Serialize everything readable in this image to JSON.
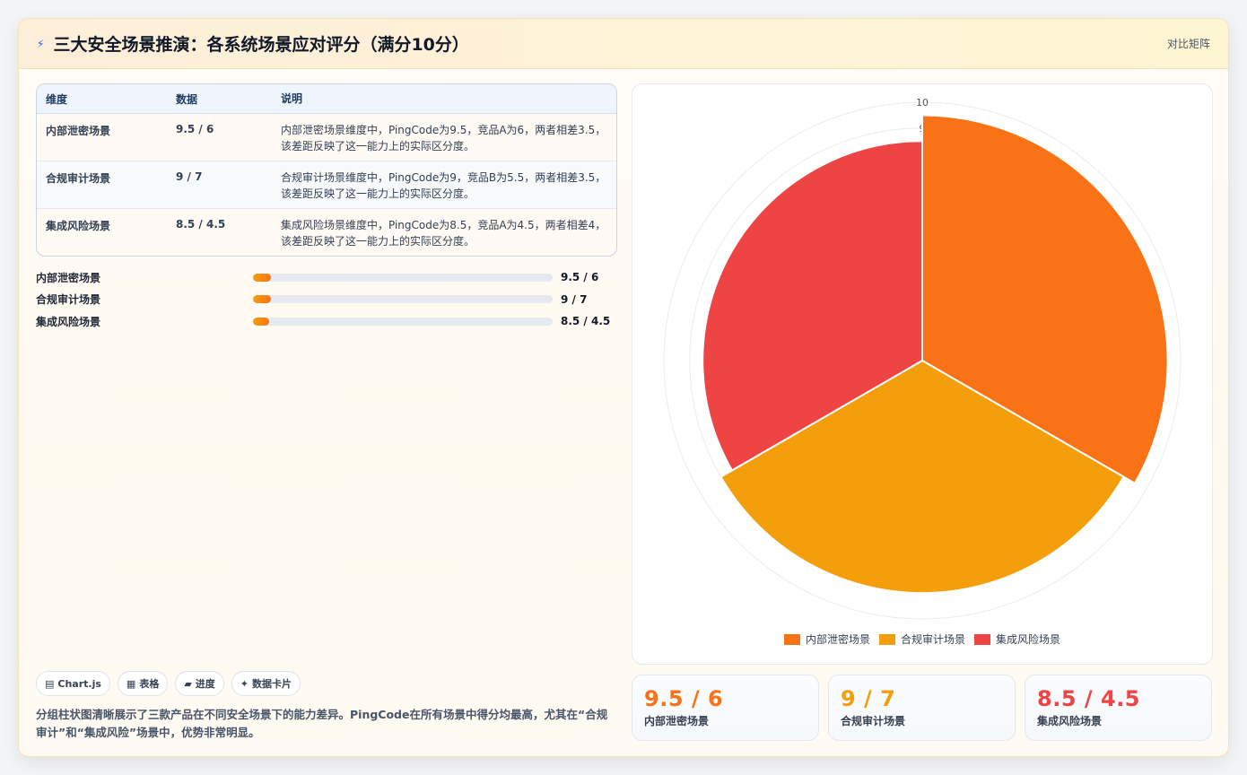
{
  "header": {
    "icon": "bolt-icon",
    "title": "三大安全场景推演：各系统场景应对评分（满分10分）",
    "switch_label": "对比矩阵"
  },
  "table": {
    "headers": [
      "维度",
      "数据",
      "说明"
    ],
    "rows": [
      {
        "dimension": "内部泄密场景",
        "data": "9.5 / 6",
        "note": "内部泄密场景维度中，PingCode为9.5，竞品A为6，两者相差3.5，该差距反映了这一能力上的实际区分度。"
      },
      {
        "dimension": "合规审计场景",
        "data": "9 / 7",
        "note": "合规审计场景维度中，PingCode为9，竞品B为5.5，两者相差3.5，该差距反映了这一能力上的实际区分度。"
      },
      {
        "dimension": "集成风险场景",
        "data": "8.5 / 4.5",
        "note": "集成风险场景维度中，PingCode为8.5，竞品A为4.5，两者相差4，该差距反映了这一能力上的实际区分度。"
      }
    ]
  },
  "progress": [
    {
      "label": "内部泄密场景",
      "value": "9.5 / 6",
      "fill": 0.06
    },
    {
      "label": "合规审计场景",
      "value": "9 / 7",
      "fill": 0.06
    },
    {
      "label": "集成风险场景",
      "value": "8.5 / 4.5",
      "fill": 0.055
    }
  ],
  "chips": [
    {
      "icon": "chart-icon",
      "glyph": "▤",
      "label": "Chart.js"
    },
    {
      "icon": "table-icon",
      "glyph": "▦",
      "label": "表格"
    },
    {
      "icon": "progress-icon",
      "glyph": "▰",
      "label": "进度"
    },
    {
      "icon": "card-icon",
      "glyph": "✦",
      "label": "数据卡片"
    }
  ],
  "summary": "分组柱状图清晰展示了三款产品在不同安全场景下的能力差异。PingCode在所有场景中得分均最高，尤其在“合规审计”和“集成风险”场景中，优势非常明显。",
  "chart_data": {
    "type": "polarArea",
    "categories": [
      "内部泄密场景",
      "合规审计场景",
      "集成风险场景"
    ],
    "values": [
      9.5,
      9,
      8.5
    ],
    "colors": [
      "#f97316",
      "#f59e0b",
      "#ef4444"
    ],
    "r_ticks": [
      1,
      2,
      3,
      4,
      5,
      6,
      7,
      8,
      9,
      10
    ],
    "r_max": 10,
    "legend_position": "bottom"
  },
  "stats": [
    {
      "value": "9.5 / 6",
      "label": "内部泄密场景",
      "color": "#f97316"
    },
    {
      "value": "9 / 7",
      "label": "合规审计场景",
      "color": "#f59e0b"
    },
    {
      "value": "8.5 / 4.5",
      "label": "集成风险场景",
      "color": "#ef4444"
    }
  ]
}
